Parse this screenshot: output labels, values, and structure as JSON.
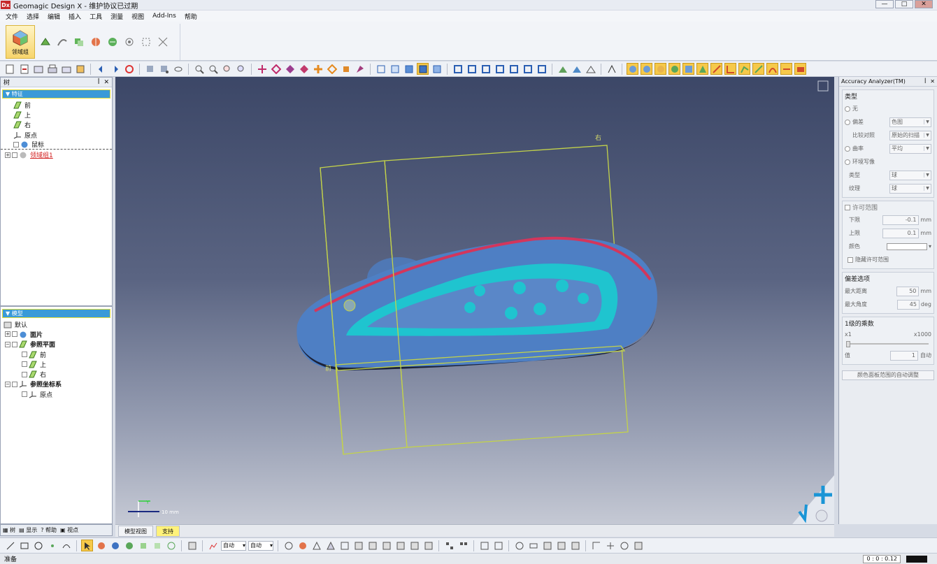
{
  "window": {
    "logo": "Dx",
    "title": "Geomagic Design X - 维护协议已过期",
    "min": "—",
    "max": "□",
    "close": "✕"
  },
  "menu": [
    "文件",
    "选择",
    "编辑",
    "插入",
    "工具",
    "测量",
    "视图",
    "Add-Ins",
    "帮助"
  ],
  "ribbon": {
    "big_button_label": "领域组"
  },
  "tree_panel": {
    "header": "树",
    "pin": "ꟾ",
    "close": "✕",
    "selected": "特征",
    "items": [
      "前",
      "上",
      "右",
      "原点",
      "鼠标",
      "领域组1"
    ]
  },
  "model_panel": {
    "selected": "模型",
    "items": [
      "默认",
      "面片",
      "参照平面",
      "前",
      "上",
      "右",
      "参照坐标系",
      "原点"
    ]
  },
  "left_tabs": [
    "树",
    "显示",
    "帮助",
    "视点"
  ],
  "viewport": {
    "label_top_right": "右",
    "label_front": "前",
    "axis_y": "Y",
    "scale": "10 mm"
  },
  "accuracy_panel": {
    "title": "Accuracy Analyzer(TM)",
    "pin": "ꟾ",
    "close": "✕",
    "type_group": "类型",
    "opt_none": "无",
    "opt_deviation": "偏差",
    "deviation_value": "色图",
    "compare_label": "比较对照",
    "compare_value": "原始的扫描",
    "opt_curvature": "曲率",
    "curvature_value": "平均",
    "opt_env": "环境写像",
    "env_type_label": "类型",
    "env_type_value": "球",
    "env_tex_label": "纹理",
    "env_tex_value": "球",
    "allow_range": "许可范围",
    "lower_label": "下限",
    "lower_value": "-0.1",
    "upper_label": "上限",
    "upper_value": "0.1",
    "unit_mm": "mm",
    "color_label": "颜色",
    "hide_range": "隐藏许可范围",
    "deviation_opts": "偏差选项",
    "max_dist_label": "最大距离",
    "max_dist_value": "50",
    "max_angle_label": "最大角度",
    "max_angle_value": "45",
    "unit_deg": "deg",
    "scale_group": "1级的乘数",
    "x1": "x1",
    "x1000": "x1000",
    "value_label": "值",
    "value_value": "1",
    "auto": "自动",
    "auto_adjust_button": "颜色面板范围的自动调整"
  },
  "view_tabs": [
    "模型视图",
    "支持"
  ],
  "bottom_toolbar": {
    "combo1": "自动",
    "combo2": "自动"
  },
  "status": {
    "text": "准备",
    "coords": "0 : 0 : 0.12"
  },
  "colors": {
    "accent": "#3a9ad8",
    "highlight": "#f6c94a",
    "cyan_region": "#1fc4cf",
    "plane_outline": "#c3d24a",
    "model_blue": "#4e7fc4"
  }
}
